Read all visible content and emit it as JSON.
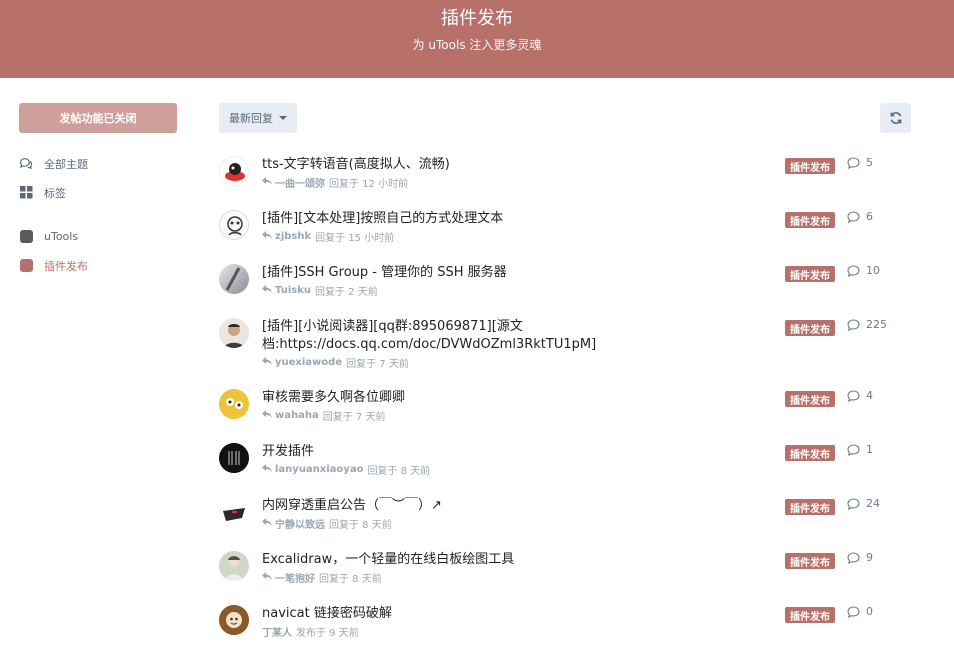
{
  "hero": {
    "title": "插件发布",
    "subtitle": "为 uTools 注入更多灵魂"
  },
  "sidebar": {
    "start_button": "发帖功能已关闭",
    "nav": [
      {
        "label": "全部主题",
        "icon": "comments-icon"
      },
      {
        "label": "标签",
        "icon": "tags-grid-icon"
      }
    ],
    "tags": [
      {
        "label": "uTools",
        "color": "#5a5a5a"
      },
      {
        "label": "插件发布",
        "color": "#b7716a",
        "active": true
      }
    ]
  },
  "toolbar": {
    "sort_label": "最新回复",
    "refresh_icon": "refresh-icon"
  },
  "colors": {
    "brand": "#b7716a",
    "hero": "#b7716a",
    "muted": "#9aa6b2"
  },
  "discussions": [
    {
      "title": "tts-文字转语音(高度拟人、流畅)",
      "user": "一曲一颂弥",
      "action": "回复于 12 小时前",
      "replied": true,
      "tag": "插件发布",
      "count": "5"
    },
    {
      "title": "[插件][文本处理]按照自己的方式处理文本",
      "user": "zjbshk",
      "action": "回复于 15 小时前",
      "replied": true,
      "tag": "插件发布",
      "count": "6"
    },
    {
      "title": "[插件]SSH Group - 管理你的 SSH 服务器",
      "user": "Tuisku",
      "action": "回复于 2 天前",
      "replied": true,
      "tag": "插件发布",
      "count": "10"
    },
    {
      "title": "[插件][小说阅读器][qq群:895069871][源文档:https://docs.qq.com/doc/DVWdOZml3RktTU1pM]",
      "user": "yuexiawode",
      "action": "回复于 7 天前",
      "replied": true,
      "tag": "插件发布",
      "count": "225"
    },
    {
      "title": "审核需要多久啊各位卿卿",
      "user": "wahaha",
      "action": "回复于 7 天前",
      "replied": true,
      "tag": "插件发布",
      "count": "4"
    },
    {
      "title": "开发插件",
      "user": "lanyuanxiaoyao",
      "action": "回复于 8 天前",
      "replied": true,
      "tag": "插件发布",
      "count": "1"
    },
    {
      "title": "内网穿透重启公告（￣︶￣）↗",
      "user": "宁静以致远",
      "action": "回复于 8 天前",
      "replied": true,
      "tag": "插件发布",
      "count": "24"
    },
    {
      "title": "Excalidraw，一个轻量的在线白板绘图工具",
      "user": "一笔抱好",
      "action": "回复于 8 天前",
      "replied": true,
      "tag": "插件发布",
      "count": "9"
    },
    {
      "title": "navicat 链接密码破解",
      "user": "丁某人",
      "action": "发布于 9 天前",
      "replied": false,
      "tag": "插件发布",
      "count": "0"
    }
  ]
}
